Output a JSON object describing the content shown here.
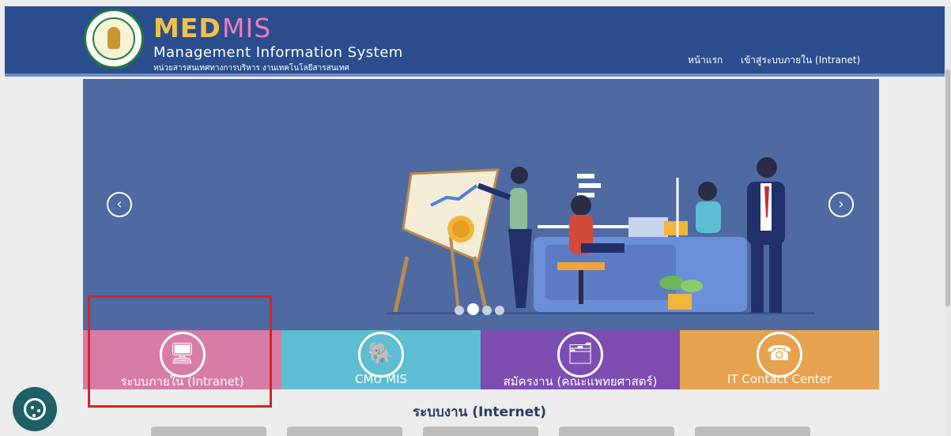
{
  "header": {
    "brand_primary": "MED",
    "brand_secondary": "MIS",
    "subtitle": "Management Information System",
    "subtitle_thai": "หน่วยสารสนเทศทางการบริหาร งานเทคโนโลยีสารสนเทศ",
    "nav": [
      "หน้าแรก",
      "เข้าสู่ระบบภายใน (Intranet)"
    ],
    "colors": {
      "background": "#2a4d8e",
      "med": "#f2c14a",
      "mis": "#f17ac4"
    }
  },
  "carousel": {
    "prev_icon": "chevron-left-icon",
    "next_icon": "chevron-right-icon",
    "slide_count": 4,
    "active_slide": 2
  },
  "tiles": [
    {
      "label": "ระบบภายใน (Intranet)",
      "icon": "computer-icon",
      "color": "#d77ca7"
    },
    {
      "label": "CMU MIS",
      "icon": "elephant-icon",
      "color": "#5ebdd3"
    },
    {
      "label": "สมัครงาน (คณะแพทยศาสตร์)",
      "icon": "job-search-icon",
      "color": "#7e4db2"
    },
    {
      "label": "IT Contact Center",
      "icon": "telephone-icon",
      "color": "#e6a24f"
    }
  ],
  "section": {
    "title": "ระบบงาน (Internet)"
  },
  "cookie": {
    "icon": "cookie-icon"
  },
  "highlight": {
    "color": "#d62424",
    "target": "ระบบภายใน (Intranet)"
  }
}
